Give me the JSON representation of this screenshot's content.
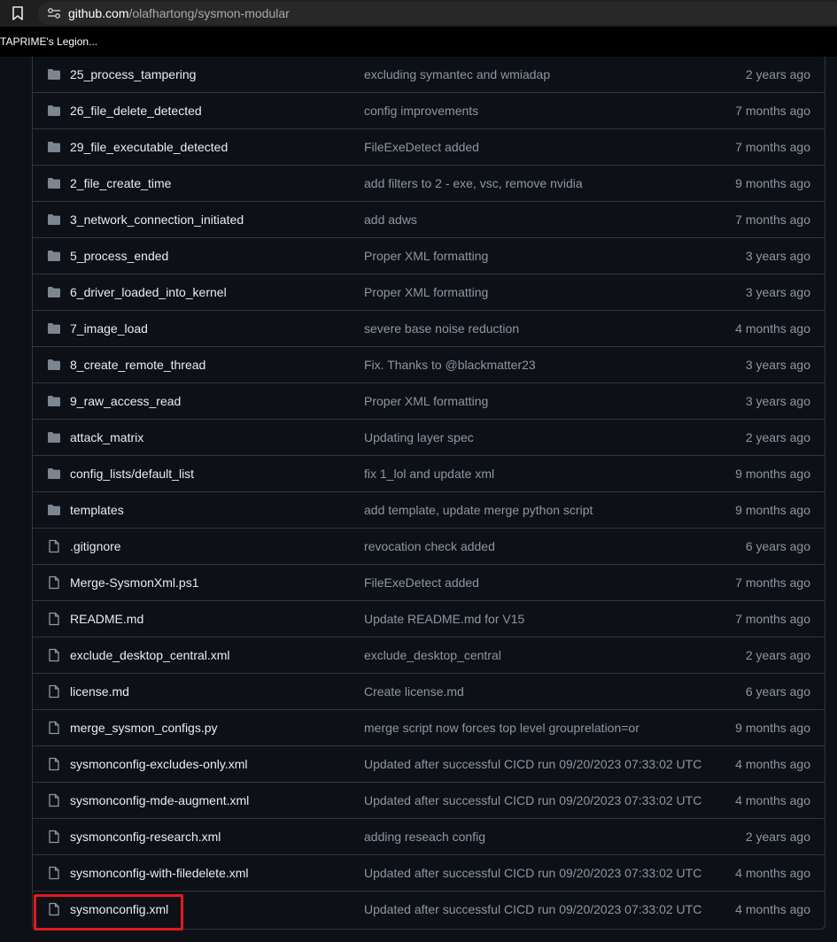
{
  "browser": {
    "url_host": "github.com",
    "url_path": "/olafhartong/sysmon-modular",
    "bookmark_label": "TAPRIME's Legion..."
  },
  "icons": {
    "bookmark": "bookmark-icon",
    "site_info": "tune-icon",
    "folder": "folder-icon",
    "file": "file-icon"
  },
  "colors": {
    "folder_icon": "#7d8590",
    "highlight": "#e21a1a"
  },
  "files": [
    {
      "type": "folder",
      "name": "25_process_tampering",
      "message": "excluding symantec and wmiadap",
      "date": "2 years ago"
    },
    {
      "type": "folder",
      "name": "26_file_delete_detected",
      "message": "config improvements",
      "date": "7 months ago"
    },
    {
      "type": "folder",
      "name": "29_file_executable_detected",
      "message": "FileExeDetect added",
      "date": "7 months ago"
    },
    {
      "type": "folder",
      "name": "2_file_create_time",
      "message": "add filters to 2 - exe, vsc, remove nvidia",
      "date": "9 months ago"
    },
    {
      "type": "folder",
      "name": "3_network_connection_initiated",
      "message": "add adws",
      "date": "7 months ago"
    },
    {
      "type": "folder",
      "name": "5_process_ended",
      "message": "Proper XML formatting",
      "date": "3 years ago"
    },
    {
      "type": "folder",
      "name": "6_driver_loaded_into_kernel",
      "message": "Proper XML formatting",
      "date": "3 years ago"
    },
    {
      "type": "folder",
      "name": "7_image_load",
      "message": "severe base noise reduction",
      "date": "4 months ago"
    },
    {
      "type": "folder",
      "name": "8_create_remote_thread",
      "message": "Fix. Thanks to @blackmatter23",
      "date": "3 years ago"
    },
    {
      "type": "folder",
      "name": "9_raw_access_read",
      "message": "Proper XML formatting",
      "date": "3 years ago"
    },
    {
      "type": "folder",
      "name": "attack_matrix",
      "message": "Updating layer spec",
      "date": "2 years ago"
    },
    {
      "type": "folder",
      "name": "config_lists/default_list",
      "message": "fix 1_lol and update xml",
      "date": "9 months ago"
    },
    {
      "type": "folder",
      "name": "templates",
      "message": "add template, update merge python script",
      "date": "9 months ago"
    },
    {
      "type": "file",
      "name": ".gitignore",
      "message": "revocation check added",
      "date": "6 years ago"
    },
    {
      "type": "file",
      "name": "Merge-SysmonXml.ps1",
      "message": "FileExeDetect added",
      "date": "7 months ago"
    },
    {
      "type": "file",
      "name": "README.md",
      "message": "Update README.md for V15",
      "date": "7 months ago"
    },
    {
      "type": "file",
      "name": "exclude_desktop_central.xml",
      "message": "exclude_desktop_central",
      "date": "2 years ago"
    },
    {
      "type": "file",
      "name": "license.md",
      "message": "Create license.md",
      "date": "6 years ago"
    },
    {
      "type": "file",
      "name": "merge_sysmon_configs.py",
      "message": "merge script now forces top level grouprelation=or",
      "date": "9 months ago"
    },
    {
      "type": "file",
      "name": "sysmonconfig-excludes-only.xml",
      "message": "Updated after successful CICD run 09/20/2023 07:33:02 UTC",
      "date": "4 months ago"
    },
    {
      "type": "file",
      "name": "sysmonconfig-mde-augment.xml",
      "message": "Updated after successful CICD run 09/20/2023 07:33:02 UTC",
      "date": "4 months ago"
    },
    {
      "type": "file",
      "name": "sysmonconfig-research.xml",
      "message": "adding reseach config",
      "date": "2 years ago"
    },
    {
      "type": "file",
      "name": "sysmonconfig-with-filedelete.xml",
      "message": "Updated after successful CICD run 09/20/2023 07:33:02 UTC",
      "date": "4 months ago"
    },
    {
      "type": "file",
      "name": "sysmonconfig.xml",
      "message": "Updated after successful CICD run 09/20/2023 07:33:02 UTC",
      "date": "4 months ago",
      "highlighted": true
    }
  ]
}
